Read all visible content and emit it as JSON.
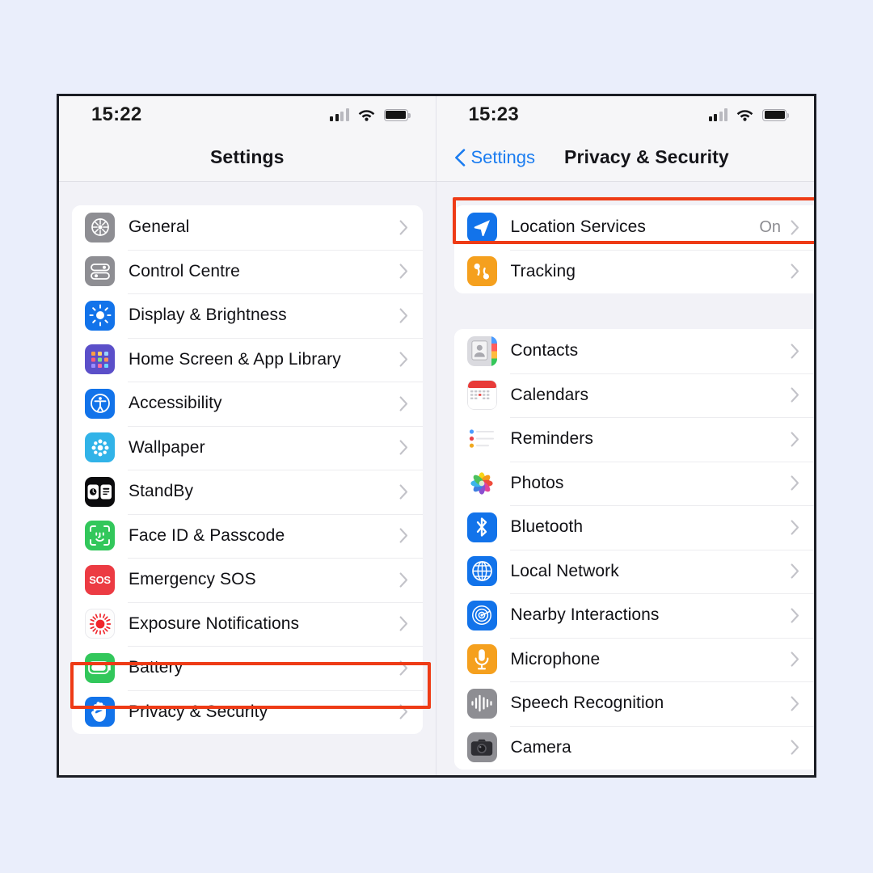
{
  "background_color": "#eaeefb",
  "highlight_color": "#ee3b16",
  "accent_blue": "#1a7cf0",
  "left_screen": {
    "status": {
      "time": "15:22",
      "signal_icon": "cellular-signal-icon",
      "wifi_icon": "wifi-icon",
      "battery_icon": "battery-full-icon"
    },
    "nav": {
      "title": "Settings"
    },
    "items": [
      {
        "label": "General",
        "icon": "general-gear-icon",
        "color": "#8e8e93"
      },
      {
        "label": "Control Centre",
        "icon": "control-centre-icon",
        "color": "#8e8e93"
      },
      {
        "label": "Display & Brightness",
        "icon": "display-brightness-icon",
        "color": "#1273ea"
      },
      {
        "label": "Home Screen & App Library",
        "icon": "home-screen-app-library-icon",
        "color": "#5b4fc9"
      },
      {
        "label": "Accessibility",
        "icon": "accessibility-icon",
        "color": "#1273ea"
      },
      {
        "label": "Wallpaper",
        "icon": "wallpaper-icon",
        "color": "#31b3e8"
      },
      {
        "label": "StandBy",
        "icon": "standby-icon",
        "color": "#0b0b0d"
      },
      {
        "label": "Face ID & Passcode",
        "icon": "face-id-passcode-icon",
        "color": "#32c75b"
      },
      {
        "label": "Emergency SOS",
        "icon": "emergency-sos-icon",
        "color": "#ec3b43"
      },
      {
        "label": "Exposure Notifications",
        "icon": "exposure-notifications-icon",
        "color": "#fdfdfd"
      },
      {
        "label": "Battery",
        "icon": "battery-icon",
        "color": "#32c75b"
      },
      {
        "label": "Privacy & Security",
        "icon": "privacy-security-hand-icon",
        "color": "#1273ea",
        "highlighted": true
      }
    ]
  },
  "right_screen": {
    "status": {
      "time": "15:23",
      "signal_icon": "cellular-signal-icon",
      "wifi_icon": "wifi-icon",
      "battery_icon": "battery-full-icon"
    },
    "nav": {
      "back_label": "Settings",
      "back_icon": "chevron-left-icon",
      "title": "Privacy & Security"
    },
    "section_one": [
      {
        "label": "Location Services",
        "icon": "location-services-arrow-icon",
        "color": "#1273ea",
        "value": "On",
        "highlighted": true
      },
      {
        "label": "Tracking",
        "icon": "tracking-icon",
        "color": "#f5a01e",
        "value": ""
      }
    ],
    "section_two": [
      {
        "label": "Contacts",
        "icon": "contacts-icon",
        "color": "#d9d9de",
        "value": ""
      },
      {
        "label": "Calendars",
        "icon": "calendars-icon",
        "color": "#ffffff",
        "value": ""
      },
      {
        "label": "Reminders",
        "icon": "reminders-icon",
        "color": "#ffffff",
        "value": ""
      },
      {
        "label": "Photos",
        "icon": "photos-icon",
        "color": "#ffffff",
        "value": ""
      },
      {
        "label": "Bluetooth",
        "icon": "bluetooth-icon",
        "color": "#1273ea",
        "value": ""
      },
      {
        "label": "Local Network",
        "icon": "local-network-globe-icon",
        "color": "#1273ea",
        "value": ""
      },
      {
        "label": "Nearby Interactions",
        "icon": "nearby-interactions-icon",
        "color": "#1273ea",
        "value": ""
      },
      {
        "label": "Microphone",
        "icon": "microphone-icon",
        "color": "#f5a01e",
        "value": ""
      },
      {
        "label": "Speech Recognition",
        "icon": "speech-recognition-icon",
        "color": "#8e8e93",
        "value": ""
      },
      {
        "label": "Camera",
        "icon": "camera-icon",
        "color": "#8e8e93",
        "value": ""
      }
    ]
  }
}
